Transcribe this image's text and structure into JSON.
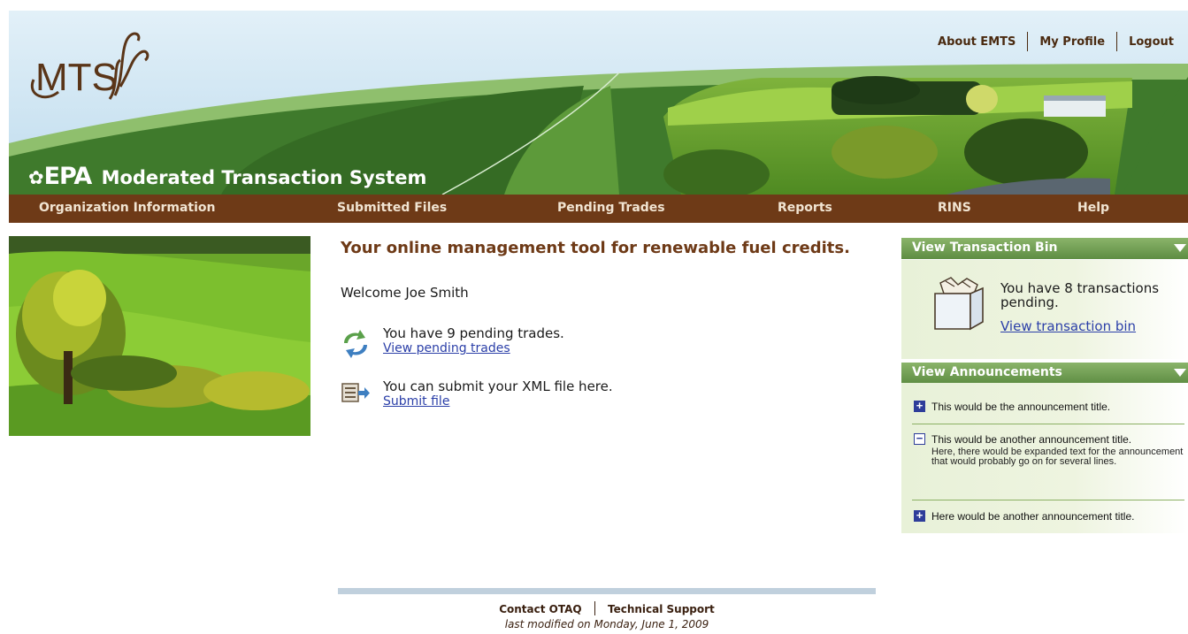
{
  "header": {
    "logo_text": "MTS",
    "epa_mark": "EPA",
    "system_name": "Moderated Transaction System",
    "top_links": [
      "About EMTS",
      "My Profile",
      "Logout"
    ]
  },
  "nav": {
    "items": [
      "Organization Information",
      "Submitted Files",
      "Pending Trades",
      "Reports",
      "RINS",
      "Help"
    ]
  },
  "main": {
    "headline": "Your online management tool for renewable fuel credits.",
    "welcome": "Welcome Joe Smith",
    "pending": {
      "text": "You have 9 pending trades.",
      "link": "View pending trades"
    },
    "submit": {
      "text": "You can submit your XML file here.",
      "link": "Submit file"
    }
  },
  "transaction_bin": {
    "title": "View Transaction Bin",
    "text": "You have 8 transactions pending.",
    "link": "View transaction bin"
  },
  "announcements": {
    "title": "View Announcements",
    "items": [
      {
        "state": "collapsed",
        "icon": "plus-icon",
        "title": "This would be the announcement title."
      },
      {
        "state": "expanded",
        "icon": "minus-icon",
        "title": "This would be another announcement title.",
        "body": "Here, there would be expanded text for the announcement that would probably go on for several lines."
      },
      {
        "state": "collapsed",
        "icon": "plus-icon",
        "title": "Here would be another announcement title."
      }
    ]
  },
  "footer": {
    "links": [
      "Contact OTAQ",
      "Technical Support"
    ],
    "modified": "last modified on Monday, June 1, 2009"
  },
  "colors": {
    "nav_brown": "#6e3a17",
    "panel_green": "#5e8d43",
    "link_blue": "#2b3fa8",
    "headline_brown": "#6e3a17"
  }
}
